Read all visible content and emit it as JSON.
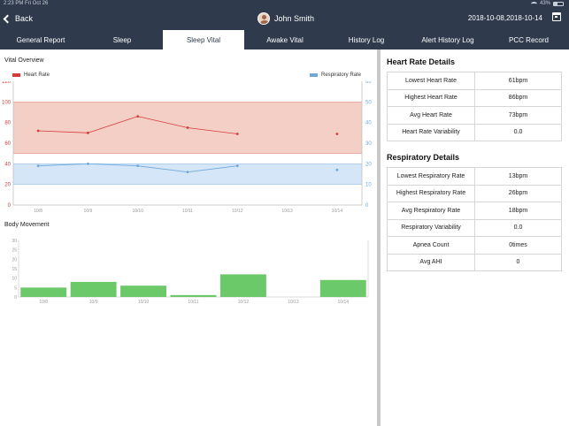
{
  "status_bar": {
    "time": "2:23 PM   Fri Oct 26",
    "battery": "43%"
  },
  "header": {
    "back_label": "Back",
    "user_name": "John Smith",
    "date_range": "2018-10-08,2018-10-14"
  },
  "tabs": [
    {
      "label": "General Report",
      "active": false
    },
    {
      "label": "Sleep",
      "active": false
    },
    {
      "label": "Sleep Vital",
      "active": true
    },
    {
      "label": "Awake Vital",
      "active": false
    },
    {
      "label": "History Log",
      "active": false
    },
    {
      "label": "Alert History Log",
      "active": false
    },
    {
      "label": "PCC Record",
      "active": false
    }
  ],
  "vital_overview": {
    "title": "Vital Overview",
    "legend_heart": "Heart Rate",
    "legend_resp": "Respiratory Rate"
  },
  "body_movement": {
    "title": "Body Movement"
  },
  "heart_rate_details": {
    "title": "Heart Rate Details",
    "rows": [
      {
        "label": "Lowest Heart Rate",
        "value": "61bpm"
      },
      {
        "label": "Highest Heart Rate",
        "value": "86bpm"
      },
      {
        "label": "Avg Heart Rate",
        "value": "73bpm"
      },
      {
        "label": "Heart Rate Variability",
        "value": "0.0"
      }
    ]
  },
  "respiratory_details": {
    "title": "Respiratory Details",
    "rows": [
      {
        "label": "Lowest Respiratory Rate",
        "value": "13bpm"
      },
      {
        "label": "Highest Respiratory Rate",
        "value": "26bpm"
      },
      {
        "label": "Avg Respiratory Rate",
        "value": "18bpm"
      },
      {
        "label": "Respiratory Variability",
        "value": "0.0"
      },
      {
        "label": "Apnea Count",
        "value": "0times"
      },
      {
        "label": "Avg AHI",
        "value": "0"
      }
    ]
  },
  "colors": {
    "header_bg": "#2f3a4c",
    "heart": "#d63b3b",
    "heart_band": "#f4cfc6",
    "resp": "#6fa8dc",
    "resp_band": "#d4e6f7",
    "movement_bar": "#6cc96a"
  },
  "chart_data": [
    {
      "type": "line",
      "title": "Vital Overview",
      "categories": [
        "10/8",
        "10/9",
        "10/10",
        "10/11",
        "10/12",
        "10/13",
        "10/14"
      ],
      "y_left_ticks": [
        "0",
        "20",
        "40",
        "60",
        "80",
        "100",
        "120"
      ],
      "y_right_ticks": [
        "0",
        "10",
        "20",
        "30",
        "40",
        "50",
        "60"
      ],
      "ylim_left": [
        0,
        120
      ],
      "ylim_right": [
        0,
        60
      ],
      "bands": [
        {
          "axis": "left",
          "from": 50,
          "to": 100,
          "color": "#f4cfc6"
        },
        {
          "axis": "left",
          "from": 20,
          "to": 40,
          "color": "#d4e6f7"
        }
      ],
      "series": [
        {
          "name": "Heart Rate",
          "axis": "left",
          "color": "#d63b3b",
          "values": [
            72,
            70,
            86,
            75,
            69,
            null,
            69
          ]
        },
        {
          "name": "Respiratory Rate",
          "axis": "right",
          "color": "#6fa8dc",
          "values": [
            19,
            20,
            19,
            16,
            19,
            null,
            17
          ]
        }
      ]
    },
    {
      "type": "bar",
      "title": "Body Movement",
      "categories": [
        "10/8",
        "10/9",
        "10/10",
        "10/11",
        "10/12",
        "10/13",
        "10/14"
      ],
      "y_ticks": [
        "0",
        "5",
        "10",
        "15",
        "20",
        "25",
        "30"
      ],
      "ylim": [
        0,
        30
      ],
      "values": [
        5,
        8,
        6,
        1,
        12,
        0,
        9
      ],
      "color": "#6cc96a"
    }
  ]
}
